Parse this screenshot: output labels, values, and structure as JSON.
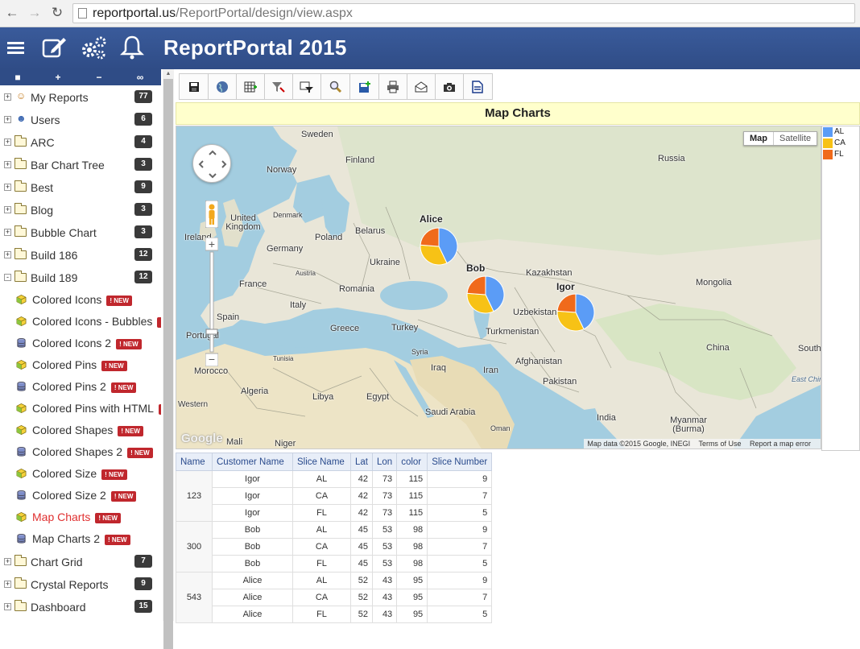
{
  "browser": {
    "url_host": "reportportal.us",
    "url_path": "/ReportPortal/design/view.aspx"
  },
  "header": {
    "title": "ReportPortal 2015"
  },
  "sidebar": {
    "folders_top": [
      {
        "label": "My Reports",
        "count": "77",
        "icon": "user-icon"
      },
      {
        "label": "Users",
        "count": "6",
        "icon": "users-icon"
      },
      {
        "label": "ARC",
        "count": "4",
        "icon": "folder-icon"
      },
      {
        "label": "Bar Chart Tree",
        "count": "3",
        "icon": "folder-icon"
      },
      {
        "label": "Best",
        "count": "9",
        "icon": "folder-icon"
      },
      {
        "label": "Blog",
        "count": "3",
        "icon": "folder-icon"
      },
      {
        "label": "Bubble Chart",
        "count": "3",
        "icon": "folder-icon"
      },
      {
        "label": "Build 186",
        "count": "12",
        "icon": "folder-icon"
      },
      {
        "label": "Build 189",
        "count": "12",
        "icon": "folder-open-icon"
      }
    ],
    "reports": [
      {
        "label": "Colored Icons",
        "badge": "! NEW",
        "icon": "cube-icon"
      },
      {
        "label": "Colored Icons - Bubbles",
        "badge": "! NEW",
        "icon": "cube-icon"
      },
      {
        "label": "Colored Icons 2",
        "badge": "! NEW",
        "icon": "database-icon"
      },
      {
        "label": "Colored Pins",
        "badge": "! NEW",
        "icon": "cube-icon"
      },
      {
        "label": "Colored Pins 2",
        "badge": "! NEW",
        "icon": "database-icon"
      },
      {
        "label": "Colored Pins with HTML",
        "badge": "! NEW",
        "icon": "cube-icon"
      },
      {
        "label": "Colored Shapes",
        "badge": "! NEW",
        "icon": "cube-icon"
      },
      {
        "label": "Colored Shapes 2",
        "badge": "! NEW",
        "icon": "database-icon"
      },
      {
        "label": "Colored Size",
        "badge": "! NEW",
        "icon": "cube-icon"
      },
      {
        "label": "Colored Size 2",
        "badge": "! NEW",
        "icon": "database-icon"
      },
      {
        "label": "Map Charts",
        "badge": "! NEW",
        "icon": "cube-icon",
        "active": true
      },
      {
        "label": "Map Charts 2",
        "badge": "! NEW",
        "icon": "database-icon"
      }
    ],
    "folders_bottom": [
      {
        "label": "Chart Grid",
        "count": "7"
      },
      {
        "label": "Crystal Reports",
        "count": "9"
      },
      {
        "label": "Dashboard",
        "count": "15"
      }
    ]
  },
  "report": {
    "title": "Map Charts"
  },
  "map": {
    "type_buttons": [
      "Map",
      "Satellite"
    ],
    "attribution": [
      "Map data ©2015 Google, INEGI",
      "Terms of Use",
      "Report a map error"
    ],
    "logo": "Google",
    "places": [
      "Sweden",
      "Finland",
      "Russia",
      "Norway",
      "Denmark",
      "United Kingdom",
      "Ireland",
      "Belarus",
      "Poland",
      "Germany",
      "Ukraine",
      "France",
      "Austria",
      "Romania",
      "Kazakhstan",
      "Mongolia",
      "Italy",
      "Spain",
      "Portugal",
      "Greece",
      "Turkey",
      "Uzbekistan",
      "Turkmenistan",
      "Syria",
      "Tunisia",
      "Morocco",
      "Iraq",
      "Iran",
      "Afghanistan",
      "China",
      "South",
      "Algeria",
      "Libya",
      "Egypt",
      "Saudi Arabia",
      "Pakistan",
      "India",
      "Oman",
      "Myanmar (Burma)",
      "Mali",
      "Niger",
      "East Chin",
      "Western"
    ],
    "pies": [
      {
        "name": "Alice",
        "slices": [
          {
            "label": "AL",
            "value": 9
          },
          {
            "label": "CA",
            "value": 7
          },
          {
            "label": "FL",
            "value": 5
          }
        ]
      },
      {
        "name": "Bob",
        "slices": [
          {
            "label": "AL",
            "value": 9
          },
          {
            "label": "CA",
            "value": 7
          },
          {
            "label": "FL",
            "value": 5
          }
        ]
      },
      {
        "name": "Igor",
        "slices": [
          {
            "label": "AL",
            "value": 9
          },
          {
            "label": "CA",
            "value": 7
          },
          {
            "label": "FL",
            "value": 5
          }
        ]
      }
    ],
    "legend": [
      {
        "label": "AL",
        "color": "#5b9cf6"
      },
      {
        "label": "CA",
        "color": "#f7c216"
      },
      {
        "label": "FL",
        "color": "#f06a1b"
      }
    ]
  },
  "table": {
    "columns": [
      "Name",
      "Customer Name",
      "Slice Name",
      "Lat",
      "Lon",
      "color",
      "Slice Number"
    ],
    "groups": [
      {
        "name": "123",
        "rows": [
          {
            "customer": "Igor",
            "slice": "AL",
            "lat": "42",
            "lon": "73",
            "color": "115",
            "number": "9"
          },
          {
            "customer": "Igor",
            "slice": "CA",
            "lat": "42",
            "lon": "73",
            "color": "115",
            "number": "7"
          },
          {
            "customer": "Igor",
            "slice": "FL",
            "lat": "42",
            "lon": "73",
            "color": "115",
            "number": "5"
          }
        ]
      },
      {
        "name": "300",
        "rows": [
          {
            "customer": "Bob",
            "slice": "AL",
            "lat": "45",
            "lon": "53",
            "color": "98",
            "number": "9"
          },
          {
            "customer": "Bob",
            "slice": "CA",
            "lat": "45",
            "lon": "53",
            "color": "98",
            "number": "7"
          },
          {
            "customer": "Bob",
            "slice": "FL",
            "lat": "45",
            "lon": "53",
            "color": "98",
            "number": "5"
          }
        ]
      },
      {
        "name": "543",
        "rows": [
          {
            "customer": "Alice",
            "slice": "AL",
            "lat": "52",
            "lon": "43",
            "color": "95",
            "number": "9"
          },
          {
            "customer": "Alice",
            "slice": "CA",
            "lat": "52",
            "lon": "43",
            "color": "95",
            "number": "7"
          },
          {
            "customer": "Alice",
            "slice": "FL",
            "lat": "52",
            "lon": "43",
            "color": "95",
            "number": "5"
          }
        ]
      }
    ]
  }
}
